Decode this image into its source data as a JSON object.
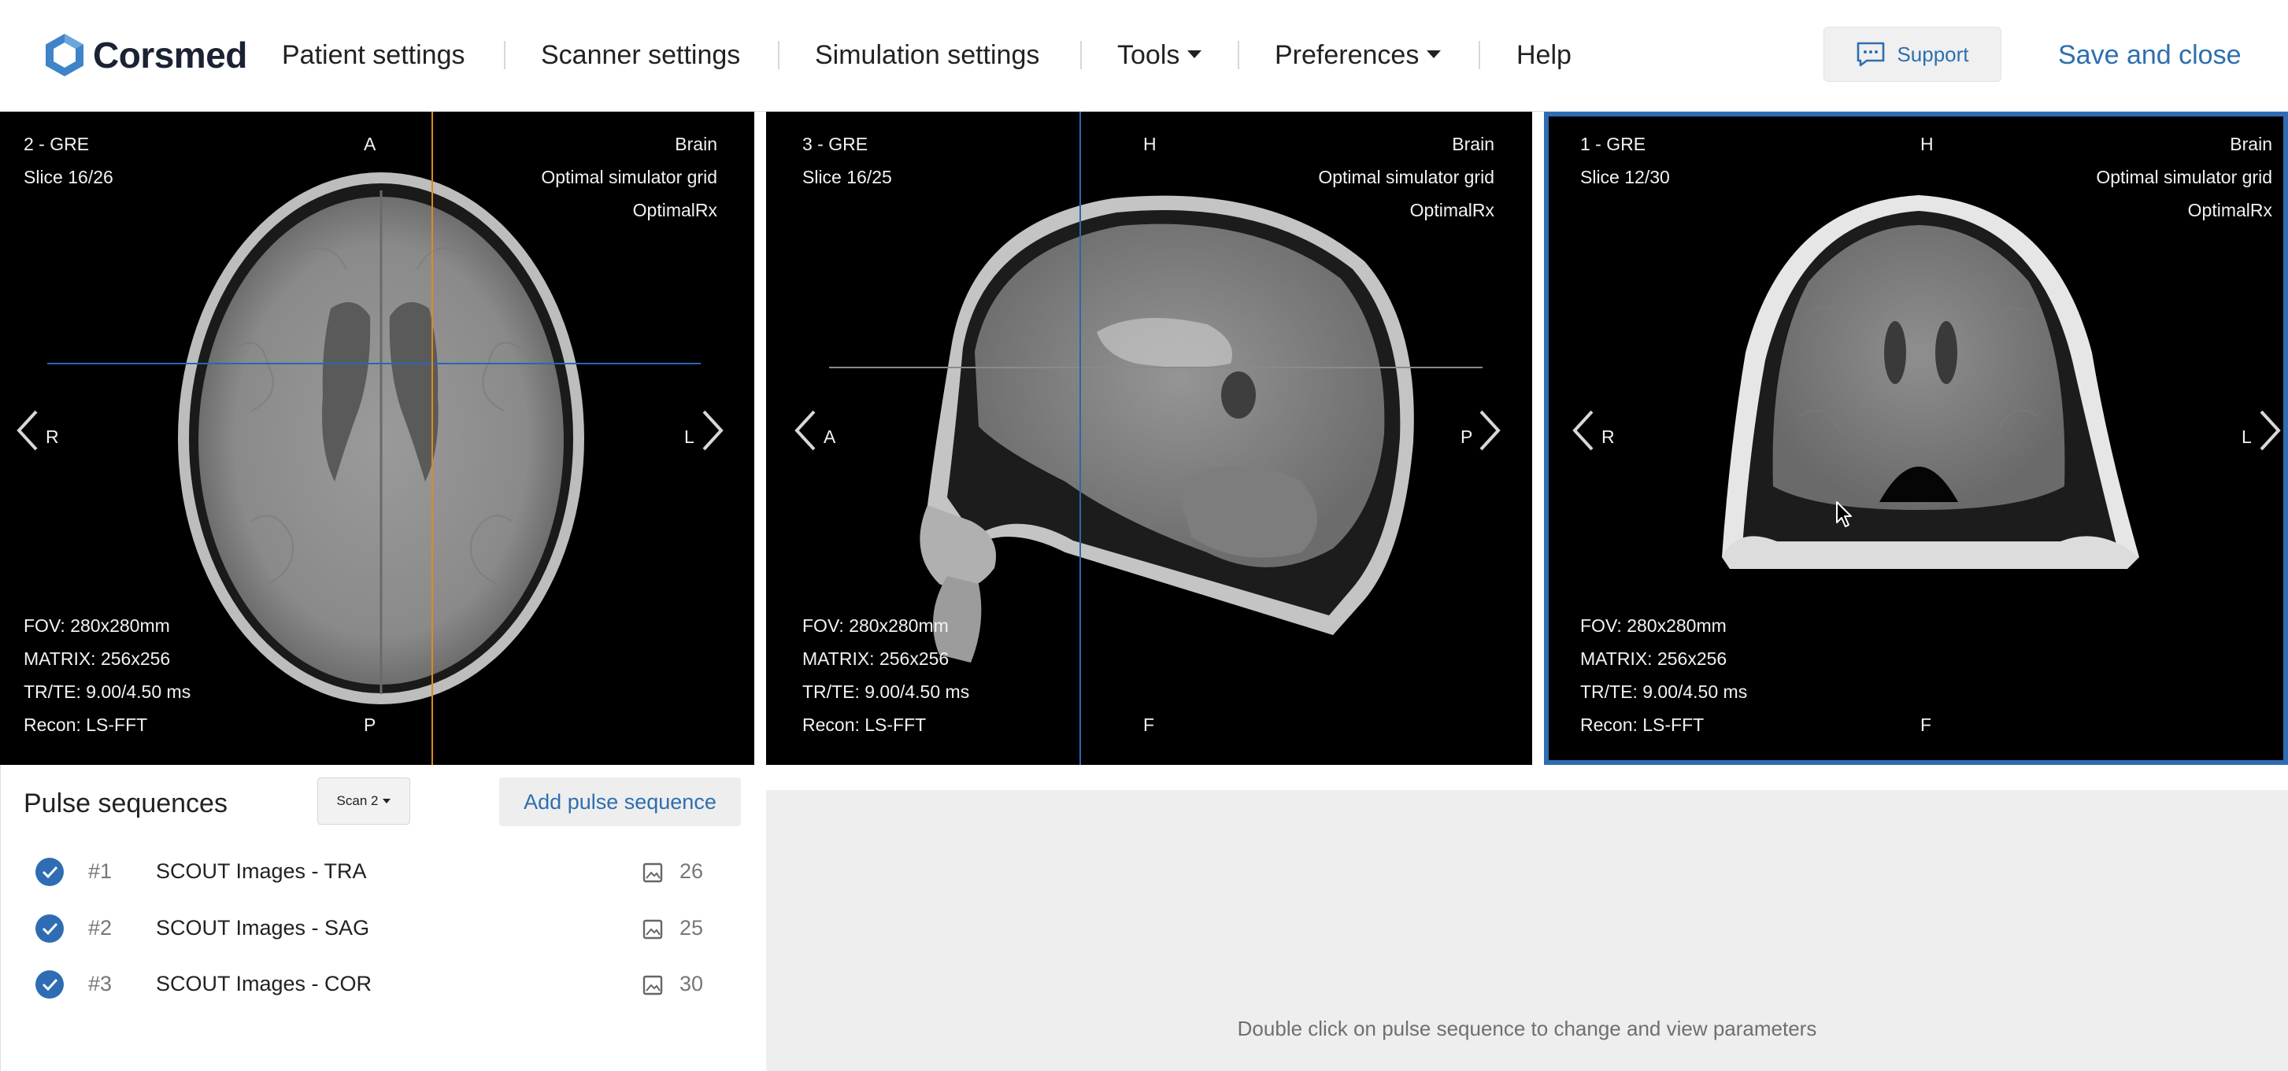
{
  "app": {
    "logo_text": "Corsmed",
    "brand_color": "#2e6db3"
  },
  "nav": {
    "items": [
      {
        "label": "Patient settings"
      },
      {
        "label": "Scanner settings"
      },
      {
        "label": "Simulation settings"
      },
      {
        "label": "Tools"
      },
      {
        "label": "Preferences"
      },
      {
        "label": "Help"
      }
    ],
    "support_label": "Support",
    "save_close_label": "Save and close"
  },
  "viewers": [
    {
      "series": "2 - GRE",
      "slice": "Slice 16/26",
      "top_label": "A",
      "bottom_label": "P",
      "left_label": "R",
      "right_label": "L",
      "region": "Brain",
      "grid": "Optimal simulator grid",
      "rx": "OptimalRx",
      "fov": "FOV: 280x280mm",
      "matrix": "MATRIX: 256x256",
      "trte": "TR/TE: 9.00/4.50 ms",
      "recon": "Recon: LS-FFT",
      "active": false
    },
    {
      "series": "3 - GRE",
      "slice": "Slice 16/25",
      "top_label": "H",
      "bottom_label": "F",
      "left_label": "A",
      "right_label": "P",
      "region": "Brain",
      "grid": "Optimal simulator grid",
      "rx": "OptimalRx",
      "fov": "FOV: 280x280mm",
      "matrix": "MATRIX: 256x256",
      "trte": "TR/TE: 9.00/4.50 ms",
      "recon": "Recon: LS-FFT",
      "active": false
    },
    {
      "series": "1 - GRE",
      "slice": "Slice 12/30",
      "top_label": "H",
      "bottom_label": "F",
      "left_label": "R",
      "right_label": "L",
      "region": "Brain",
      "grid": "Optimal simulator grid",
      "rx": "OptimalRx",
      "fov": "FOV: 280x280mm",
      "matrix": "MATRIX: 256x256",
      "trte": "TR/TE: 9.00/4.50 ms",
      "recon": "Recon: LS-FFT",
      "active": true
    }
  ],
  "pulse_sequences": {
    "title": "Pulse sequences",
    "scan_selector": "Scan 2",
    "add_label": "Add pulse sequence",
    "items": [
      {
        "num": "#1",
        "name": "SCOUT Images - TRA",
        "count": "26",
        "checked": true
      },
      {
        "num": "#2",
        "name": "SCOUT Images - SAG",
        "count": "25",
        "checked": true
      },
      {
        "num": "#3",
        "name": "SCOUT Images - COR",
        "count": "30",
        "checked": true
      }
    ]
  },
  "parameters": {
    "hint": "Double click on pulse sequence to change and view parameters"
  }
}
